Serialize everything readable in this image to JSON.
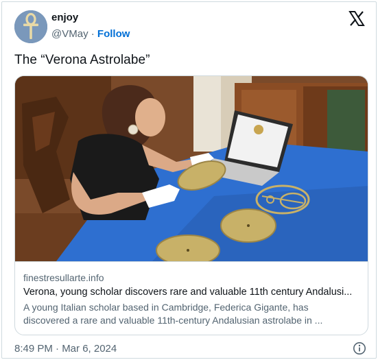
{
  "author": {
    "display_name": "enjoy",
    "handle": "@VMay",
    "follow_label": "Follow",
    "avatar_icon": "ankh-icon"
  },
  "platform_icon": "x-logo-icon",
  "tweet": {
    "text": "The “Verona Astrolabe”"
  },
  "link_card": {
    "domain": "finestresullarte.info",
    "title": "Verona, young scholar discovers rare and valuable 11th century Andalusi...",
    "description_line1": "A young Italian scholar based in Cambridge, Federica Gigante, has",
    "description_line2": "discovered a rare and valuable 11th-century Andalusian astrolabe in ..."
  },
  "timestamp": "8:49 PM · Mar 6, 2024",
  "colors": {
    "follow": "#006fd6",
    "border": "#cfd9de",
    "muted_text": "#536471",
    "table_cloth": "#2e6fd0",
    "brass": "#c8b168"
  }
}
